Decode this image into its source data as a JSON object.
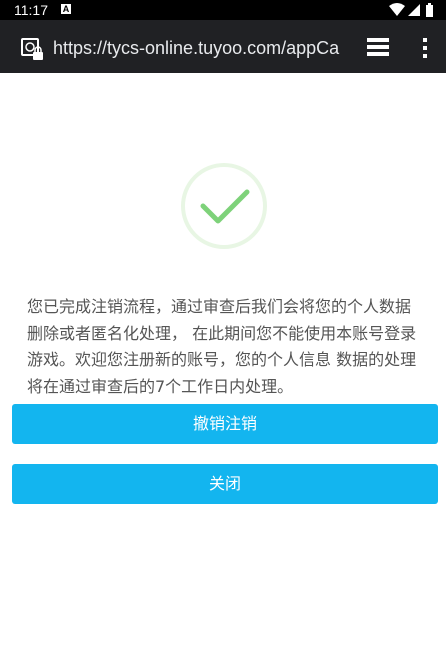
{
  "status_bar": {
    "time": "11:17",
    "notification_glyph": "A",
    "icons": [
      "wifi-icon",
      "signal-icon",
      "battery-icon"
    ]
  },
  "browser": {
    "url": "https://tycs-online.tuyoo.com/appCa",
    "icons": [
      "site-info-icon",
      "tabs-icon",
      "menu-icon"
    ]
  },
  "page": {
    "success_icon": "checkmark-icon",
    "message": "您已完成注销流程，通过审查后我们会将您的个人数据删除或者匿名化处理， 在此期间您不能使用本账号登录游戏。欢迎您注册新的账号，您的个人信息 数据的处理将在通过审查后的7个工作日内处理。",
    "revoke_button_label": "撤销注销",
    "close_button_label": "关闭"
  },
  "colors": {
    "button": "#13b5ef",
    "check": "#7ed27a",
    "check_ring": "#e8f6e4",
    "url_bar": "#202124",
    "message_text": "#555555"
  }
}
